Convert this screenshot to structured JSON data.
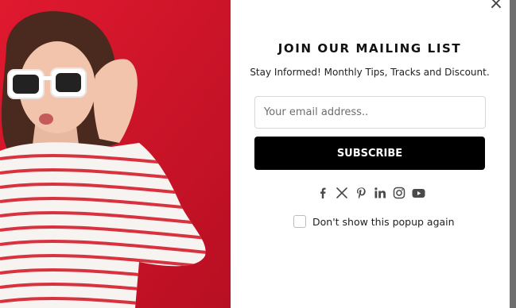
{
  "popup": {
    "title": "JOIN OUR MAILING LIST",
    "subtitle": "Stay Informed! Monthly Tips, Tracks and Discount.",
    "close_label": "×",
    "email": {
      "placeholder": "Your email address..",
      "value": ""
    },
    "subscribe_label": "SUBSCRIBE",
    "social_icons": [
      "facebook-icon",
      "x-icon",
      "pinterest-icon",
      "linkedin-icon",
      "instagram-icon",
      "youtube-icon"
    ],
    "dont_show_label": "Don't show this popup again",
    "dont_show_checked": false
  },
  "colors": {
    "image_background": "#d0162b",
    "button": "#000000",
    "button_text": "#ffffff",
    "backdrop": "#6f6f6f",
    "icon": "#4a4a4a"
  }
}
